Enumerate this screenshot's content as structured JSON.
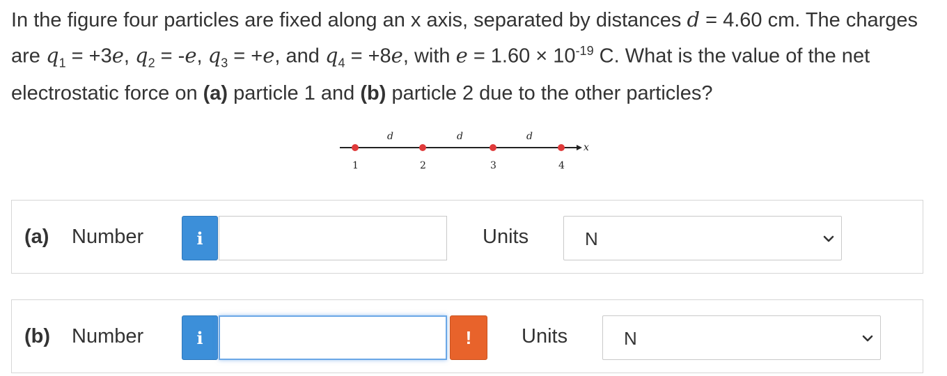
{
  "question": {
    "p1": "In the figure four particles are fixed along an x axis, separated by distances",
    "d_sym": "d",
    "d_eq": "= 4.60 cm. The charges are",
    "q1": "q",
    "q1_sub": "1",
    "q1_val": "= +3",
    "q2_sub": "2",
    "q2_val": "= -",
    "q3_sub": "3",
    "q3_val": "= +",
    "q4_sub": "4",
    "q4_val": "= +8",
    "e_sym": "e",
    "with": ", with",
    "e_eq": "= 1.60 × 10",
    "exp": "-19",
    "tail": "C. What is the value of the net electrostatic force on",
    "a_label": "(a)",
    "mid": "particle 1 and",
    "b_label": "(b)",
    "end": "particle 2 due to the other particles?"
  },
  "figure": {
    "d_labels": [
      "d",
      "d",
      "d"
    ],
    "particle_labels": [
      "1",
      "2",
      "3",
      "4"
    ],
    "axis_label": "x",
    "particle_color": "#e03a3a"
  },
  "rows": [
    {
      "part": "(a)",
      "number_label": "Number",
      "info_icon": "i",
      "value": "",
      "units_label": "Units",
      "units_value": "N"
    },
    {
      "part": "(b)",
      "number_label": "Number",
      "info_icon": "i",
      "warning_icon": "!",
      "value": "",
      "units_label": "Units",
      "units_value": "N"
    }
  ],
  "colors": {
    "info_button": "#3c8fd9",
    "warning_button": "#e8632b",
    "focus_border": "#6aa7e6"
  }
}
